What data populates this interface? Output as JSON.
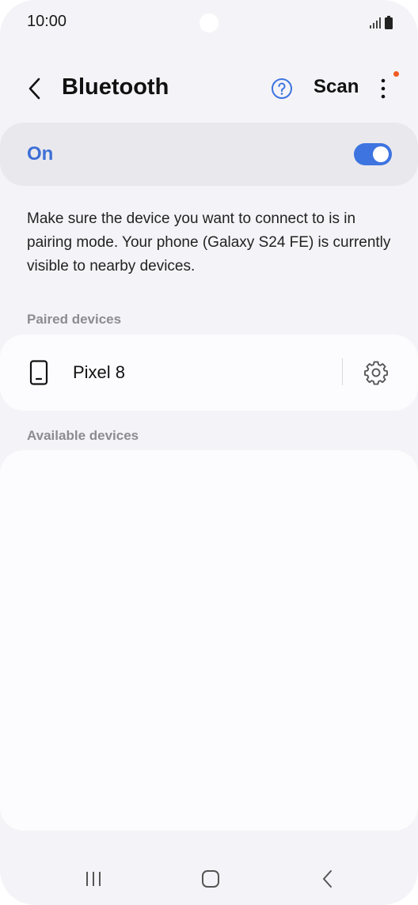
{
  "status_bar": {
    "time": "10:00",
    "signal_icon": "signal-icon",
    "battery_icon": "battery-icon"
  },
  "header": {
    "title": "Bluetooth",
    "back_icon": "chevron-left-icon",
    "help_icon": "help-circle-icon",
    "scan_label": "Scan",
    "more_icon": "more-vertical-icon"
  },
  "bluetooth_toggle": {
    "label": "On",
    "enabled": true
  },
  "description": "Make sure the device you want to connect to is in pairing mode. Your phone (Galaxy S24 FE) is currently visible to nearby devices.",
  "paired_devices": {
    "label": "Paired devices",
    "items": [
      {
        "name": "Pixel 8",
        "icon": "phone-icon",
        "settings_icon": "gear-icon"
      }
    ]
  },
  "available_devices": {
    "label": "Available devices",
    "items": []
  },
  "nav_bar": {
    "recents_icon": "recents-icon",
    "home_icon": "home-icon",
    "back_icon": "back-icon"
  },
  "colors": {
    "accent": "#3d74e0",
    "background": "#f4f3f7",
    "card": "#fcfcfe",
    "notification_dot": "#f05a23"
  }
}
